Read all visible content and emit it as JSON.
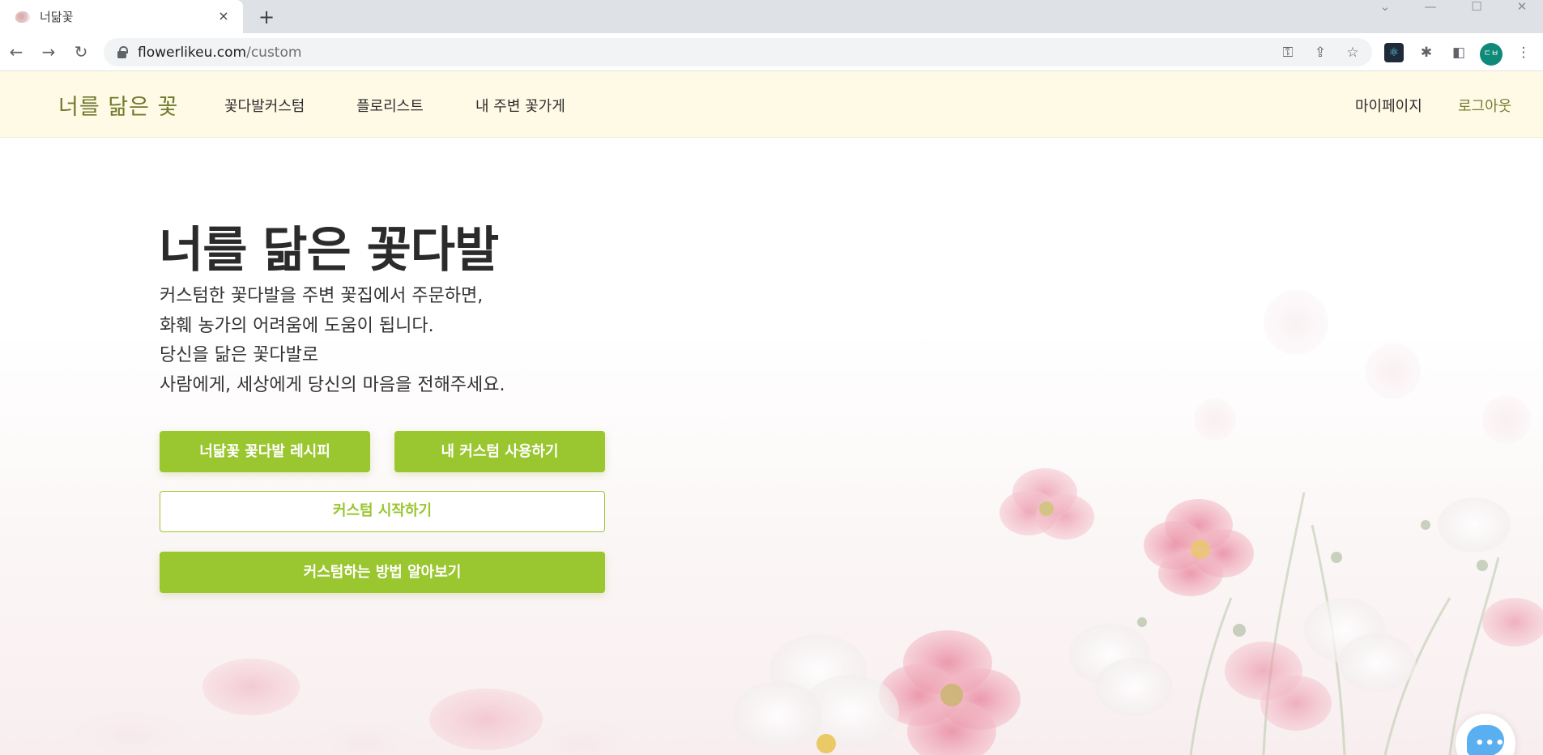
{
  "browser": {
    "tab_title": "너닮꽃",
    "tab_close": "×",
    "new_tab": "+",
    "back": "←",
    "forward": "→",
    "reload": "↻",
    "url_host": "flowerlikeu.com",
    "url_path": "/custom",
    "omnibox_icons": {
      "key": "⚿",
      "share": "⇪",
      "star": "☆"
    },
    "ext_icons": {
      "react": "⚛",
      "puzzle": "✱",
      "sidepanel": "◧",
      "menu": "⋮"
    },
    "profile_initials": "ㄷㅂ",
    "window_controls": {
      "down": "⌄",
      "minimize": "—",
      "maximize": "☐",
      "close": "✕"
    }
  },
  "header": {
    "logo": "너를 닮은 꽃",
    "nav": [
      "꽃다발커스텀",
      "플로리스트",
      "내 주변 꽃가게"
    ],
    "mypage": "마이페이지",
    "logout": "로그아웃"
  },
  "hero": {
    "title": "너를 닮은 꽃다발",
    "lines": [
      "커스텀한 꽃다발을 주변 꽃집에서 주문하면,",
      "화훼 농가의 어려움에 도움이 됩니다.",
      "당신을 닮은 꽃다발로",
      "사람에게, 세상에게 당신의 마음을 전해주세요."
    ]
  },
  "buttons": {
    "recipe": "너닮꽃 꽃다발 레시피",
    "use_custom": "내 커스텀 사용하기",
    "start_custom": "커스텀 시작하기",
    "how_to": "커스텀하는 방법 알아보기"
  },
  "chat": {
    "dots": "•••"
  },
  "colors": {
    "accent_green": "#9ac62f",
    "header_bg": "#fffae6",
    "logo_olive": "#6f7a2e",
    "logout_olive": "#7a7a32",
    "chat_blue": "#5aaff0"
  }
}
